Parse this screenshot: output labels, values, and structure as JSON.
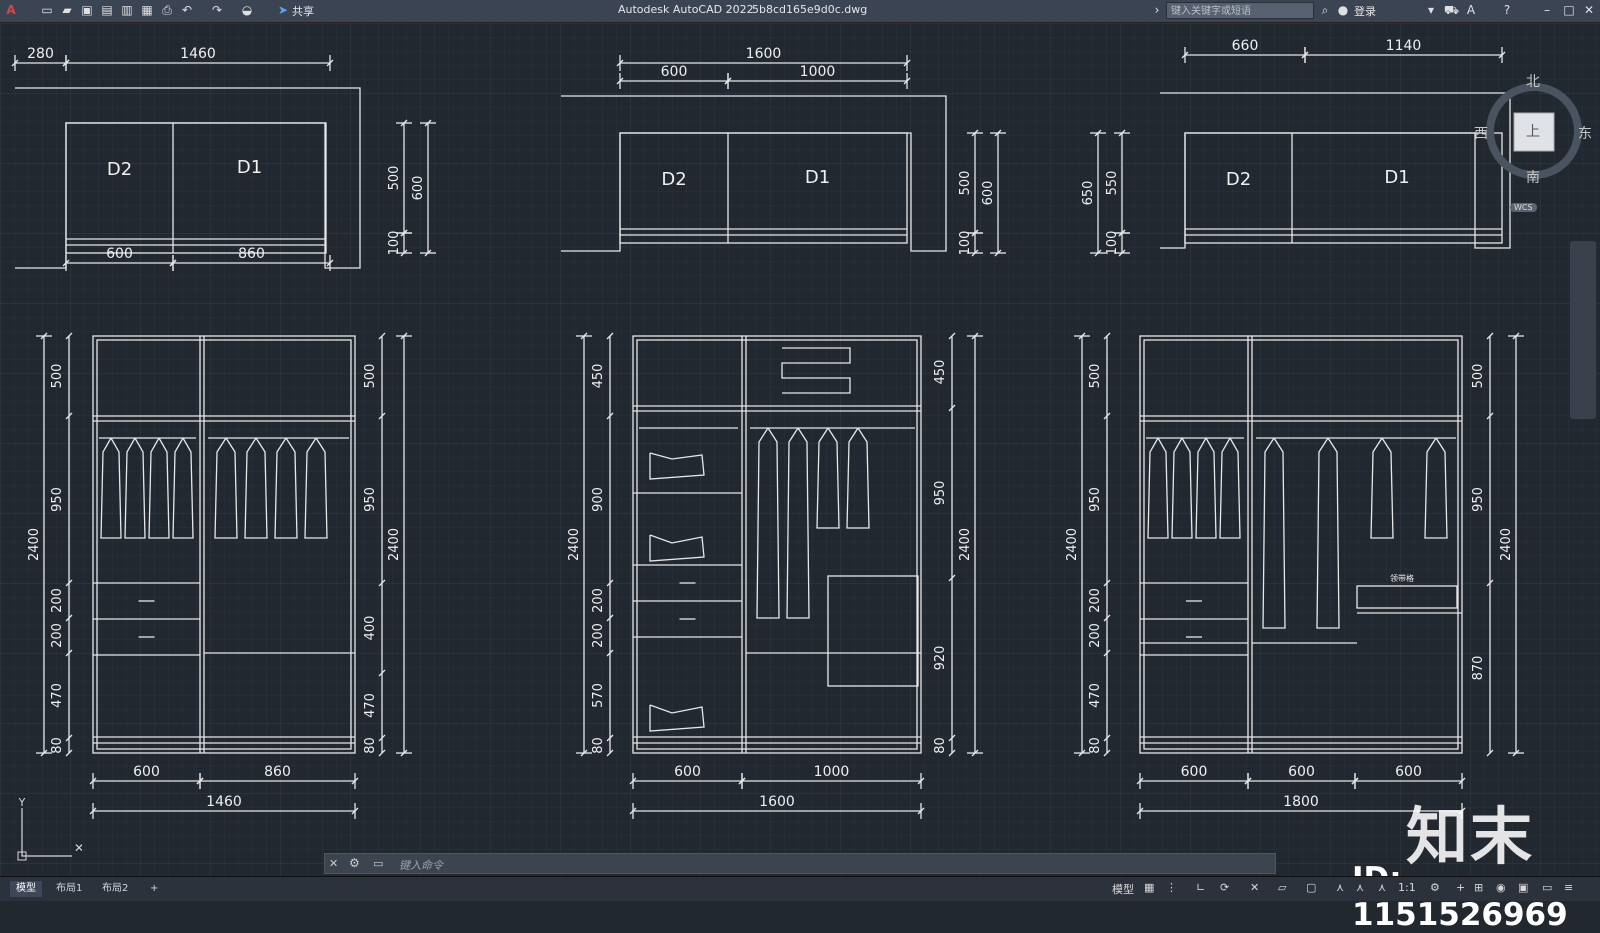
{
  "window": {
    "app_title": "Autodesk AutoCAD 2022",
    "filename": "5b8cd165e9d0c.dwg",
    "share_label": "共享",
    "search_placeholder": "键入关键字或短语",
    "login_label": "登录"
  },
  "viewcube": {
    "north": "北",
    "south": "南",
    "east": "东",
    "west": "西",
    "top": "上",
    "wcs": "WCS"
  },
  "command": {
    "placeholder": "键入命令"
  },
  "layout_tabs": [
    {
      "label": "模型",
      "active": true
    },
    {
      "label": "布局1",
      "active": false
    },
    {
      "label": "布局2",
      "active": false
    },
    {
      "label": "+",
      "active": false
    }
  ],
  "status": {
    "model_label": "模型",
    "scale": "1:1"
  },
  "watermark": {
    "brand": "知末",
    "id": "ID: 1151526969"
  },
  "drawing": {
    "plans": [
      {
        "door_left": "D2",
        "door_right": "D1",
        "top_dims": [
          "280",
          "1460"
        ],
        "bottom_dims": [
          "600",
          "860"
        ],
        "side_dims": [
          "500",
          "600",
          "100"
        ]
      },
      {
        "door_left": "D2",
        "door_right": "D1",
        "top_dims": [
          "1600",
          "600",
          "1000"
        ],
        "side_dims": [
          "500",
          "600",
          "100"
        ]
      },
      {
        "door_left": "D2",
        "door_right": "D1",
        "top_dims": [
          "660",
          "1140"
        ],
        "side_dims": [
          "650",
          "550",
          "100"
        ]
      }
    ],
    "elevations": [
      {
        "left_dims": [
          "500",
          "950",
          "200",
          "200",
          "470",
          "80"
        ],
        "total": "2400",
        "right_dims": [
          "500",
          "950",
          "400",
          "470",
          "80"
        ],
        "bottom_dims": [
          "600",
          "860"
        ],
        "bottom_total": "1460"
      },
      {
        "left_dims": [
          "450",
          "900",
          "200",
          "200",
          "570",
          "80"
        ],
        "total": "2400",
        "right_dims": [
          "450",
          "950",
          "920",
          "80"
        ],
        "bottom_dims": [
          "600",
          "1000"
        ],
        "bottom_total": "1600"
      },
      {
        "left_dims": [
          "500",
          "950",
          "200",
          "200",
          "470",
          "80"
        ],
        "total": "2400",
        "right_dims": [
          "500",
          "950",
          "870"
        ],
        "bottom_dims": [
          "600",
          "600",
          "600"
        ],
        "bottom_total": "1800",
        "tie_rack_label": "领带格"
      }
    ]
  }
}
